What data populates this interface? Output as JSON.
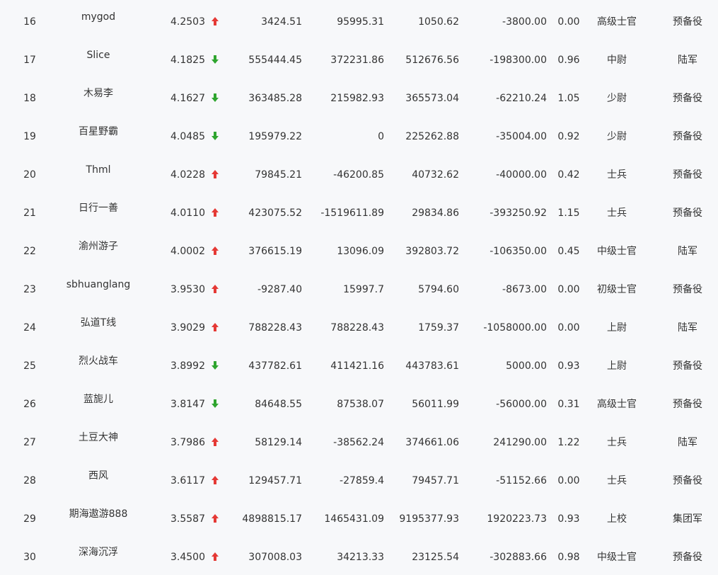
{
  "rows": [
    {
      "rank": "16",
      "name": "mygod",
      "score": "4.2503",
      "trend": "up",
      "total": "3424.51",
      "v2": "95995.31",
      "v3": "1050.62",
      "v4": "-3800.00",
      "ratio": "0.00",
      "military_rank": "高级士官",
      "unit": "预备役"
    },
    {
      "rank": "17",
      "name": "Slice",
      "score": "4.1825",
      "trend": "down",
      "total": "555444.45",
      "v2": "372231.86",
      "v3": "512676.56",
      "v4": "-198300.00",
      "ratio": "0.96",
      "military_rank": "中尉",
      "unit": "陆军"
    },
    {
      "rank": "18",
      "name": "木易李",
      "score": "4.1627",
      "trend": "down",
      "total": "363485.28",
      "v2": "215982.93",
      "v3": "365573.04",
      "v4": "-62210.24",
      "ratio": "1.05",
      "military_rank": "少尉",
      "unit": "预备役"
    },
    {
      "rank": "19",
      "name": "百星野霸",
      "score": "4.0485",
      "trend": "down",
      "total": "195979.22",
      "v2": "0",
      "v3": "225262.88",
      "v4": "-35004.00",
      "ratio": "0.92",
      "military_rank": "少尉",
      "unit": "预备役"
    },
    {
      "rank": "20",
      "name": "Thml",
      "score": "4.0228",
      "trend": "up",
      "total": "79845.21",
      "v2": "-46200.85",
      "v3": "40732.62",
      "v4": "-40000.00",
      "ratio": "0.42",
      "military_rank": "士兵",
      "unit": "预备役"
    },
    {
      "rank": "21",
      "name": "日行一善",
      "score": "4.0110",
      "trend": "up",
      "total": "423075.52",
      "v2": "-1519611.89",
      "v3": "29834.86",
      "v4": "-393250.92",
      "ratio": "1.15",
      "military_rank": "士兵",
      "unit": "预备役"
    },
    {
      "rank": "22",
      "name": "渝州游子",
      "score": "4.0002",
      "trend": "up",
      "total": "376615.19",
      "v2": "13096.09",
      "v3": "392803.72",
      "v4": "-106350.00",
      "ratio": "0.45",
      "military_rank": "中级士官",
      "unit": "陆军"
    },
    {
      "rank": "23",
      "name": "sbhuanglang",
      "score": "3.9530",
      "trend": "up",
      "total": "-9287.40",
      "v2": "15997.7",
      "v3": "5794.60",
      "v4": "-8673.00",
      "ratio": "0.00",
      "military_rank": "初级士官",
      "unit": "预备役"
    },
    {
      "rank": "24",
      "name": "弘道T线",
      "score": "3.9029",
      "trend": "up",
      "total": "788228.43",
      "v2": "788228.43",
      "v3": "1759.37",
      "v4": "-1058000.00",
      "ratio": "0.00",
      "military_rank": "上尉",
      "unit": "陆军"
    },
    {
      "rank": "25",
      "name": "烈火战车",
      "score": "3.8992",
      "trend": "down",
      "total": "437782.61",
      "v2": "411421.16",
      "v3": "443783.61",
      "v4": "5000.00",
      "ratio": "0.93",
      "military_rank": "上尉",
      "unit": "预备役"
    },
    {
      "rank": "26",
      "name": "蓝旎儿",
      "score": "3.8147",
      "trend": "down",
      "total": "84648.55",
      "v2": "87538.07",
      "v3": "56011.99",
      "v4": "-56000.00",
      "ratio": "0.31",
      "military_rank": "高级士官",
      "unit": "预备役"
    },
    {
      "rank": "27",
      "name": "土豆大神",
      "score": "3.7986",
      "trend": "up",
      "total": "58129.14",
      "v2": "-38562.24",
      "v3": "374661.06",
      "v4": "241290.00",
      "ratio": "1.22",
      "military_rank": "士兵",
      "unit": "陆军"
    },
    {
      "rank": "28",
      "name": "西风",
      "score": "3.6117",
      "trend": "up",
      "total": "129457.71",
      "v2": "-27859.4",
      "v3": "79457.71",
      "v4": "-51152.66",
      "ratio": "0.00",
      "military_rank": "士兵",
      "unit": "预备役"
    },
    {
      "rank": "29",
      "name": "期海遨游888",
      "score": "3.5587",
      "trend": "up",
      "total": "4898815.17",
      "v2": "1465431.09",
      "v3": "9195377.93",
      "v4": "1920223.73",
      "ratio": "0.93",
      "military_rank": "上校",
      "unit": "集团军"
    },
    {
      "rank": "30",
      "name": "深海沉浮",
      "score": "3.4500",
      "trend": "up",
      "total": "307008.03",
      "v2": "34213.33",
      "v3": "23125.54",
      "v4": "-302883.66",
      "ratio": "0.98",
      "military_rank": "中级士官",
      "unit": "预备役"
    }
  ],
  "colors": {
    "up": "#e53935",
    "down": "#2ea52e",
    "text": "#333333",
    "background": "#f7f8fa"
  },
  "icons": {
    "up": "arrow-up-icon",
    "down": "arrow-down-icon"
  }
}
